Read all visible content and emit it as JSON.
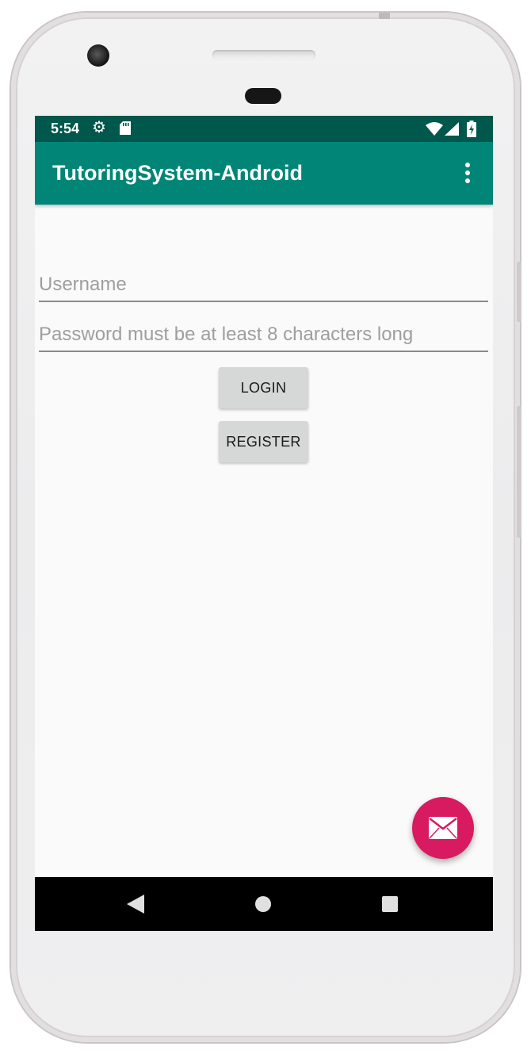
{
  "status_bar": {
    "time": "5:54",
    "icons": [
      "gear-icon",
      "sd-card-icon",
      "wifi-icon",
      "cell-signal-icon",
      "battery-charging-icon"
    ]
  },
  "app_bar": {
    "title": "TutoringSystem-Android",
    "overflow_icon": "more-vert-icon"
  },
  "form": {
    "username": {
      "value": "",
      "placeholder": "Username"
    },
    "password": {
      "value": "",
      "placeholder": "Password must be at least 8 characters long"
    },
    "login_label": "LOGIN",
    "register_label": "REGISTER"
  },
  "fab": {
    "icon": "email-icon"
  },
  "nav_bar": {
    "icons": [
      "back-icon",
      "home-icon",
      "recents-icon"
    ]
  },
  "colors": {
    "status_bar": "#00574b",
    "app_bar": "#008577",
    "fab": "#d81b60",
    "background": "#fafafa",
    "button": "#d6d7d7"
  }
}
